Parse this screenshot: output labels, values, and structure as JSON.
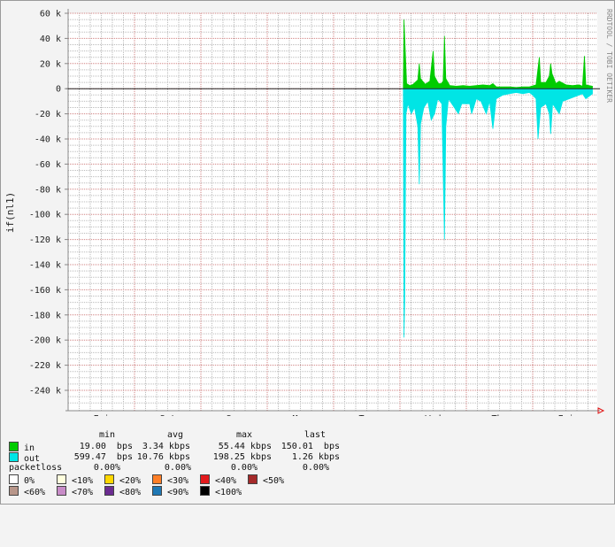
{
  "chart_data": {
    "type": "area",
    "ylabel": "if(nl1)",
    "watermark": "RRDTOOL / TOBI OETIKER",
    "ylim": [
      -250000,
      60000
    ],
    "yticks": [
      {
        "v": 60000,
        "label": "60 k"
      },
      {
        "v": 40000,
        "label": "40 k"
      },
      {
        "v": 20000,
        "label": "20 k"
      },
      {
        "v": 0,
        "label": "0"
      },
      {
        "v": -20000,
        "label": "-20 k"
      },
      {
        "v": -40000,
        "label": "-40 k"
      },
      {
        "v": -60000,
        "label": "-60 k"
      },
      {
        "v": -80000,
        "label": "-80 k"
      },
      {
        "v": -100000,
        "label": "-100 k"
      },
      {
        "v": -120000,
        "label": "-120 k"
      },
      {
        "v": -140000,
        "label": "-140 k"
      },
      {
        "v": -160000,
        "label": "-160 k"
      },
      {
        "v": -180000,
        "label": "-180 k"
      },
      {
        "v": -200000,
        "label": "-200 k"
      },
      {
        "v": -220000,
        "label": "-220 k"
      },
      {
        "v": -240000,
        "label": "-240 k"
      }
    ],
    "days": [
      "Fri",
      "Sat",
      "Sun",
      "Mon",
      "Tue",
      "Wed",
      "Thu",
      "Fri"
    ],
    "xrange_days": [
      0,
      8
    ],
    "series": [
      {
        "name": "in",
        "color": "#00cc00",
        "points": [
          [
            5.05,
            1000
          ],
          [
            5.06,
            55000
          ],
          [
            5.08,
            30000
          ],
          [
            5.1,
            4000
          ],
          [
            5.15,
            2500
          ],
          [
            5.2,
            3500
          ],
          [
            5.27,
            7000
          ],
          [
            5.29,
            20000
          ],
          [
            5.31,
            8000
          ],
          [
            5.38,
            3500
          ],
          [
            5.45,
            6000
          ],
          [
            5.5,
            30000
          ],
          [
            5.52,
            10000
          ],
          [
            5.58,
            4000
          ],
          [
            5.62,
            4000
          ],
          [
            5.65,
            6000
          ],
          [
            5.67,
            42000
          ],
          [
            5.69,
            8000
          ],
          [
            5.75,
            2500
          ],
          [
            5.85,
            2000
          ],
          [
            5.95,
            2500
          ],
          [
            6.05,
            2000
          ],
          [
            6.15,
            2500
          ],
          [
            6.25,
            3000
          ],
          [
            6.35,
            2500
          ],
          [
            6.4,
            4000
          ],
          [
            6.45,
            1500
          ],
          [
            6.55,
            1500
          ],
          [
            6.65,
            1500
          ],
          [
            6.75,
            1000
          ],
          [
            6.85,
            1500
          ],
          [
            6.95,
            1500
          ],
          [
            7.05,
            3000
          ],
          [
            7.1,
            25000
          ],
          [
            7.12,
            5000
          ],
          [
            7.2,
            5000
          ],
          [
            7.25,
            10000
          ],
          [
            7.27,
            20000
          ],
          [
            7.29,
            12000
          ],
          [
            7.35,
            4000
          ],
          [
            7.4,
            6000
          ],
          [
            7.5,
            3000
          ],
          [
            7.6,
            2500
          ],
          [
            7.7,
            3000
          ],
          [
            7.75,
            2000
          ],
          [
            7.78,
            26000
          ],
          [
            7.8,
            3000
          ],
          [
            7.9,
            2000
          ]
        ]
      },
      {
        "name": "out",
        "color": "#00e5e5",
        "points": [
          [
            5.05,
            -2000
          ],
          [
            5.06,
            -198000
          ],
          [
            5.07,
            -170000
          ],
          [
            5.09,
            -20000
          ],
          [
            5.12,
            -12000
          ],
          [
            5.17,
            -20000
          ],
          [
            5.22,
            -15000
          ],
          [
            5.27,
            -30000
          ],
          [
            5.29,
            -76000
          ],
          [
            5.31,
            -28000
          ],
          [
            5.36,
            -15000
          ],
          [
            5.42,
            -10000
          ],
          [
            5.47,
            -25000
          ],
          [
            5.52,
            -20000
          ],
          [
            5.57,
            -8000
          ],
          [
            5.63,
            -12000
          ],
          [
            5.67,
            -120000
          ],
          [
            5.69,
            -30000
          ],
          [
            5.73,
            -8000
          ],
          [
            5.82,
            -15000
          ],
          [
            5.88,
            -20000
          ],
          [
            5.93,
            -12000
          ],
          [
            6.05,
            -12000
          ],
          [
            6.08,
            -20000
          ],
          [
            6.15,
            -8000
          ],
          [
            6.22,
            -10000
          ],
          [
            6.3,
            -20000
          ],
          [
            6.35,
            -10000
          ],
          [
            6.4,
            -32000
          ],
          [
            6.45,
            -8000
          ],
          [
            6.55,
            -5000
          ],
          [
            6.65,
            -4000
          ],
          [
            6.75,
            -3000
          ],
          [
            6.85,
            -4000
          ],
          [
            6.95,
            -3000
          ],
          [
            7.0,
            -5000
          ],
          [
            7.05,
            -8000
          ],
          [
            7.08,
            -40000
          ],
          [
            7.12,
            -15000
          ],
          [
            7.2,
            -12000
          ],
          [
            7.25,
            -20000
          ],
          [
            7.27,
            -36000
          ],
          [
            7.3,
            -12000
          ],
          [
            7.4,
            -20000
          ],
          [
            7.45,
            -10000
          ],
          [
            7.55,
            -8000
          ],
          [
            7.65,
            -6000
          ],
          [
            7.75,
            -4000
          ],
          [
            7.8,
            -8000
          ],
          [
            7.9,
            -4000
          ]
        ]
      }
    ]
  },
  "legend": {
    "headers": [
      "min",
      "avg",
      "max",
      "last"
    ],
    "rows": [
      {
        "name": "in",
        "color": "#00cc00",
        "min": "19.00  bps",
        "avg": "3.34 kbps",
        "max": "55.44 kbps",
        "last": "150.01  bps"
      },
      {
        "name": "out",
        "color": "#00e5e5",
        "min": "599.47  bps",
        "avg": "10.76 kbps",
        "max": "198.25 kbps",
        "last": "1.26 kbps"
      },
      {
        "name": "packetloss",
        "color": "",
        "min": "0.00%",
        "avg": "0.00%",
        "max": "0.00%",
        "last": "0.00%"
      }
    ],
    "loss_scale_row1": [
      {
        "label": "0%",
        "color": "#ffffff"
      },
      {
        "label": "<10%",
        "color": "#ffffdd"
      },
      {
        "label": "<20%",
        "color": "#ffd700"
      },
      {
        "label": "<30%",
        "color": "#ff7f27"
      },
      {
        "label": "<40%",
        "color": "#e31a1c"
      },
      {
        "label": "<50%",
        "color": "#a52a2a"
      }
    ],
    "loss_scale_row2": [
      {
        "label": "<60%",
        "color": "#b8968a"
      },
      {
        "label": "<70%",
        "color": "#c88cc8"
      },
      {
        "label": "<80%",
        "color": "#6b2c91"
      },
      {
        "label": "<90%",
        "color": "#1f78b4"
      },
      {
        "label": "<100%",
        "color": "#000000"
      }
    ]
  }
}
